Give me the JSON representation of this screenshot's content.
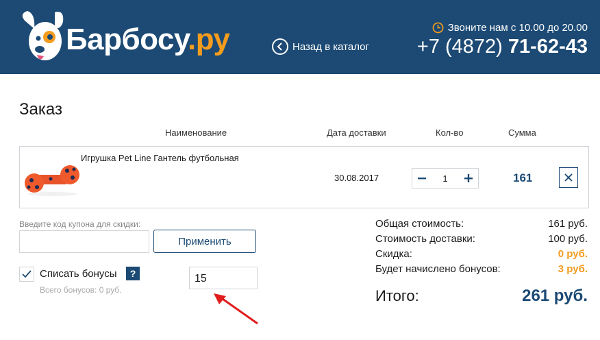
{
  "header": {
    "brand_main": "Барбосу",
    "brand_tld": ".ру",
    "back_label": "Назад в каталог",
    "hours": "Звоните нам с 10.00 до 20.00",
    "phone_prefix": "+7 (4872)",
    "phone_number": "71-62-43"
  },
  "page": {
    "title": "Заказ"
  },
  "table": {
    "headers": {
      "name": "Наименование",
      "date": "Дата доставки",
      "qty": "Кол-во",
      "sum": "Сумма"
    },
    "items": [
      {
        "name": "Игрушка Pet Line Гантель футбольная",
        "delivery_date": "30.08.2017",
        "quantity": "1",
        "sum": "161"
      }
    ]
  },
  "coupon": {
    "label": "Введите код купона для скидки:",
    "value": "",
    "apply_label": "Применить"
  },
  "bonus": {
    "checked": true,
    "label": "Списать бонусы",
    "help": "?",
    "total_text": "Всего бонусов: 0 руб.",
    "input_value": "15"
  },
  "summary": {
    "rows": [
      {
        "label": "Общая стоимость:",
        "value": "161 руб."
      },
      {
        "label": "Стоимость доставки:",
        "value": "100 руб."
      },
      {
        "label": "Скидка:",
        "value": "0 руб."
      },
      {
        "label": "Будет начислено бонусов:",
        "value": "3 руб."
      }
    ],
    "total_label": "Итого:",
    "total_value": "261 руб."
  },
  "colors": {
    "header_bg": "#1c4a74",
    "accent": "#f39c1e",
    "annotation_arrow": "#e11d1d"
  },
  "icons": [
    "dog-logo-icon",
    "chevron-left-icon",
    "clock-icon",
    "minus-icon",
    "plus-icon",
    "close-icon",
    "check-icon",
    "question-icon",
    "red-arrow-icon"
  ]
}
